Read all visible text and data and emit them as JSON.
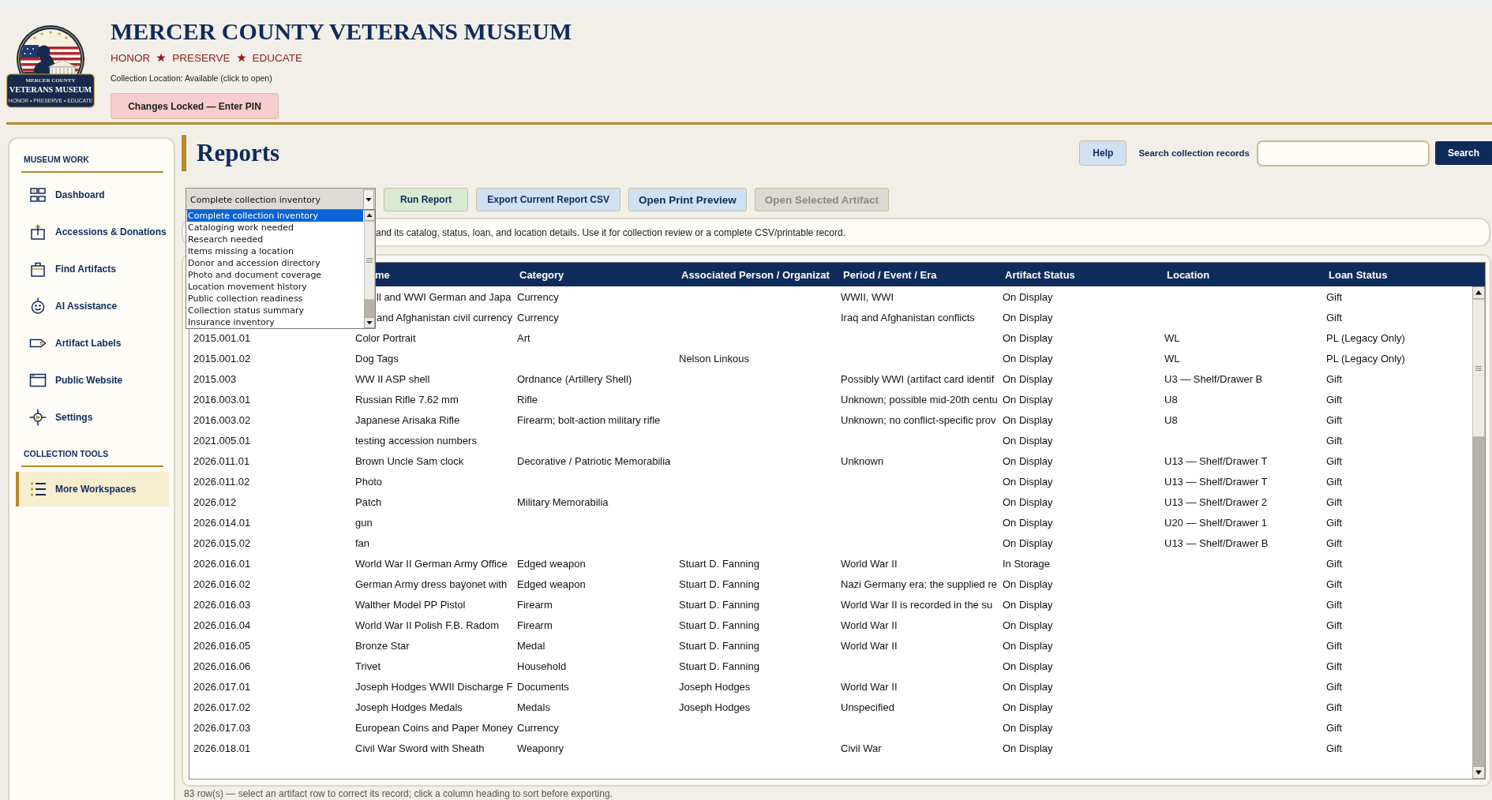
{
  "app_header": {
    "logo": {
      "line_1": "MERCER COUNTY",
      "line_2": "VETERANS MUSEUM",
      "motto": "HONOR • PRESERVE • EDUCATE"
    },
    "title": "MERCER COUNTY VETERANS MUSEUM",
    "tagline": [
      "HONOR",
      "PRESERVE",
      "EDUCATE"
    ],
    "collection_location": "Collection Location: Available (click to open)",
    "pin_button": "Changes Locked — Enter PIN"
  },
  "sidebar": {
    "sections": [
      {
        "title": "MUSEUM WORK",
        "items": [
          {
            "label": "Dashboard",
            "selected": false
          },
          {
            "label": "Accessions & Donations",
            "selected": false
          },
          {
            "label": "Find Artifacts",
            "selected": false
          },
          {
            "label": "AI Assistance",
            "selected": false
          },
          {
            "label": "Artifact Labels",
            "selected": false
          },
          {
            "label": "Public Website",
            "selected": false
          },
          {
            "label": "Settings",
            "selected": false
          }
        ]
      },
      {
        "title": "COLLECTION TOOLS",
        "items": [
          {
            "label": "More Workspaces",
            "selected": true
          }
        ]
      }
    ]
  },
  "page": {
    "title": "Reports",
    "help_button": "Help",
    "search": {
      "label": "Search collection records",
      "button": "Search"
    }
  },
  "report_select": {
    "value": "Complete collection inventory",
    "expanded": true,
    "options": [
      {
        "label": "Complete collection inventory",
        "selected": true
      },
      {
        "label": "Cataloging work needed",
        "selected": false
      },
      {
        "label": "Research needed",
        "selected": false
      },
      {
        "label": "Items missing a location",
        "selected": false
      },
      {
        "label": "Donor and accession directory",
        "selected": false
      },
      {
        "label": "Photo and document coverage",
        "selected": false
      },
      {
        "label": "Location movement history",
        "selected": false
      },
      {
        "label": "Public collection readiness",
        "selected": false
      },
      {
        "label": "Collection status summary",
        "selected": false
      },
      {
        "label": "Insurance inventory",
        "selected": false
      }
    ]
  },
  "toolbar_buttons": [
    {
      "label": "Run Report",
      "kind": "primary",
      "disabled": false
    },
    {
      "label": "Export Current Report CSV",
      "kind": "secondary",
      "disabled": false
    },
    {
      "label": "Open Print Preview",
      "kind": "emphasized",
      "disabled": false
    },
    {
      "label": "Open Selected Artifact",
      "kind": "emphasized",
      "disabled": true
    }
  ],
  "description": "and its catalog, status, loan, and location details. Use it for collection review or a complete CSV/printable record.",
  "table": {
    "columns": [
      null,
      "me",
      "Category",
      "Associated Person / Organizat",
      "Period / Event / Era",
      "Artifact Status",
      "Location",
      "Loan Status"
    ],
    "rows": [
      [
        null,
        "ll and WWI German and Japa",
        "Currency",
        null,
        "WWII, WWI",
        "On Display",
        null,
        "Gift"
      ],
      [
        null,
        "and Afghanistan civil currency",
        "Currency",
        null,
        "Iraq and Afghanistan conflicts",
        "On Display",
        null,
        "Gift"
      ],
      [
        "2015.001.01",
        "Color Portrait",
        "Art",
        null,
        null,
        "On Display",
        "WL",
        "PL (Legacy Only)"
      ],
      [
        "2015.001.02",
        "Dog Tags",
        null,
        "Nelson Linkous",
        null,
        "On Display",
        "WL",
        "PL (Legacy Only)"
      ],
      [
        "2015.003",
        "WW II ASP shell",
        "Ordnance (Artillery Shell)",
        null,
        "Possibly WWI (artifact card identif",
        "On Display",
        "U3 — Shelf/Drawer B",
        "Gift"
      ],
      [
        "2016.003.01",
        "Russian Rifle 7.62 mm",
        "Rifle",
        null,
        "Unknown; possible mid-20th centu",
        "On Display",
        "U8",
        "Gift"
      ],
      [
        "2016.003.02",
        "Japanese Arisaka Rifle",
        "Firearm; bolt-action military rifle",
        null,
        "Unknown; no conflict-specific prov",
        "On Display",
        "U8",
        "Gift"
      ],
      [
        "2021.005.01",
        "testing accession numbers",
        null,
        null,
        null,
        "On Display",
        null,
        "Gift"
      ],
      [
        "2026.011.01",
        "Brown Uncle Sam clock",
        "Decorative / Patriotic Memorabilia",
        null,
        "Unknown",
        "On Display",
        "U13 — Shelf/Drawer T",
        "Gift"
      ],
      [
        "2026.011.02",
        "Photo",
        null,
        null,
        null,
        "On Display",
        "U13 — Shelf/Drawer T",
        "Gift"
      ],
      [
        "2026.012",
        "Patch",
        "Military Memorabilia",
        null,
        null,
        "On Display",
        "U13 — Shelf/Drawer 2",
        "Gift"
      ],
      [
        "2026.014.01",
        "gun",
        null,
        null,
        null,
        "On Display",
        "U20 — Shelf/Drawer 1",
        "Gift"
      ],
      [
        "2026.015.02",
        "fan",
        null,
        null,
        null,
        "On Display",
        "U13 — Shelf/Drawer B",
        "Gift"
      ],
      [
        "2026.016.01",
        "World War II German Army Office",
        "Edged weapon",
        "Stuart D. Fanning",
        "World War II",
        "In Storage",
        null,
        "Gift"
      ],
      [
        "2026.016.02",
        "German Army dress bayonet with",
        "Edged weapon",
        "Stuart D. Fanning",
        "Nazi Germany era; the supplied re",
        "On Display",
        null,
        "Gift"
      ],
      [
        "2026.016.03",
        "Walther Model PP Pistol",
        "Firearm",
        "Stuart D. Fanning",
        "World War II is recorded in the su",
        "On Display",
        null,
        "Gift"
      ],
      [
        "2026.016.04",
        "World War II Polish F.B. Radom",
        "Firearm",
        "Stuart D. Fanning",
        "World War II",
        "On Display",
        null,
        "Gift"
      ],
      [
        "2026.016.05",
        "Bronze Star",
        "Medal",
        "Stuart D. Fanning",
        "World War II",
        "On Display",
        null,
        "Gift"
      ],
      [
        "2026.016.06",
        "Trivet",
        "Household",
        "Stuart D. Fanning",
        null,
        "On Display",
        null,
        "Gift"
      ],
      [
        "2026.017.01",
        "Joseph Hodges WWII Discharge F",
        "Documents",
        "Joseph Hodges",
        "World War II",
        "On Display",
        null,
        "Gift"
      ],
      [
        "2026.017.02",
        "Joseph Hodges Medals",
        "Medals",
        "Joseph Hodges",
        "Unspecified",
        "On Display",
        null,
        "Gift"
      ],
      [
        "2026.017.03",
        "European Coins and Paper Money",
        "Currency",
        null,
        null,
        "On Display",
        null,
        "Gift"
      ],
      [
        "2026.018.01",
        "Civil War Sword with Sheath",
        "Weaponry",
        null,
        "Civil War",
        "On Display",
        null,
        "Gift"
      ]
    ]
  },
  "status_text": "83 row(s) — select an artifact row to correct its record; click a column heading to sort before exporting."
}
